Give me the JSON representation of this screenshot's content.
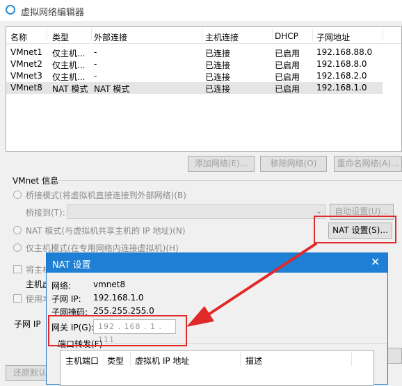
{
  "window": {
    "title": "虚拟网络编辑器"
  },
  "network_table": {
    "columns": [
      "名称",
      "类型",
      "外部连接",
      "主机连接",
      "DHCP",
      "子网地址"
    ],
    "rows": [
      [
        "VMnet1",
        "仅主机...",
        "-",
        "已连接",
        "已启用",
        "192.168.88.0"
      ],
      [
        "VMnet2",
        "仅主机...",
        "-",
        "已连接",
        "已启用",
        "192.168.8.0"
      ],
      [
        "VMnet3",
        "仅主机...",
        "-",
        "已连接",
        "已启用",
        "192.168.2.0"
      ],
      [
        "VMnet8",
        "NAT 模式",
        "NAT 模式",
        "已连接",
        "已启用",
        "192.168.1.0"
      ]
    ],
    "selected_row": 3
  },
  "table_buttons": {
    "add": "添加网络(E)...",
    "remove": "移除网络(O)",
    "rename": "重命名网络(A)..."
  },
  "vmnet_info": {
    "group_label": "VMnet 信息",
    "bridge_mode": "桥接模式(将虚拟机直接连接到外部网络)(B)",
    "bridge_to_label": "桥接到(T):",
    "auto_settings": "自动设置(U)...",
    "nat_mode": "NAT 模式(与虚拟机共享主机的 IP 地址)(N)",
    "nat_settings": "NAT 设置(S)...",
    "host_only_mode": "仅主机模式(在专用网络内连接虚拟机)(H)",
    "connect_host_adapter_partial": "将主机",
    "host_adapter_partial": "主机虚",
    "use_dhcp_partial": "使用本",
    "subnet_ip_partial": "子网 IP",
    "restore_defaults_partial": "还原默认"
  },
  "nat_dialog": {
    "title": "NAT 设置",
    "network_label": "网络:",
    "network_value": "vmnet8",
    "subnet_ip_label": "子网 IP:",
    "subnet_ip_value": "192.168.1.0",
    "subnet_mask_label": "子网掩码:",
    "subnet_mask_value": "255.255.255.0",
    "gateway_label": "网关 IP(G):",
    "gateway_value": "192 . 168 . 1 . 111",
    "port_forwarding_label": "端口转发(F)",
    "port_columns": [
      "主机端口",
      "类型",
      "虚拟机 IP 地址",
      "描述"
    ]
  },
  "colors": {
    "titlebar_accent": "#1e7fd4",
    "highlight": "#e02a2a"
  }
}
